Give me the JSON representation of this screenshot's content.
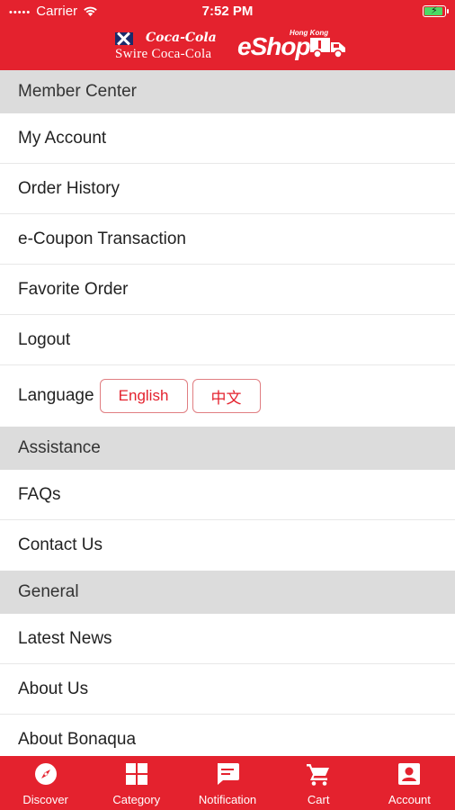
{
  "status_bar": {
    "carrier": "Carrier",
    "time": "7:52 PM",
    "battery_level": 0.85
  },
  "header": {
    "coca_cola_script": "Coca-Cola",
    "swire_text": "Swire Coca-Cola",
    "eshop_tagline": "Hong Kong",
    "eshop_text": "eShop"
  },
  "sections": [
    {
      "title": "Member Center",
      "items": [
        "My Account",
        "Order History",
        "e-Coupon Transaction",
        "Favorite Order",
        "Logout"
      ]
    },
    {
      "title": "Assistance",
      "items": [
        "FAQs",
        "Contact Us"
      ]
    },
    {
      "title": "General",
      "items": [
        "Latest News",
        "About Us",
        "About Bonaqua"
      ]
    }
  ],
  "language": {
    "label": "Language",
    "options": [
      "English",
      "中文"
    ]
  },
  "tabbar": {
    "tabs": [
      {
        "label": "Discover",
        "icon": "compass-icon"
      },
      {
        "label": "Category",
        "icon": "grid-icon"
      },
      {
        "label": "Notification",
        "icon": "chat-bubble-icon"
      },
      {
        "label": "Cart",
        "icon": "cart-icon"
      },
      {
        "label": "Account",
        "icon": "account-icon"
      }
    ]
  },
  "colors": {
    "brand_red": "#e4222e",
    "section_gray": "#dcdcdc",
    "battery_green": "#4cd964"
  }
}
